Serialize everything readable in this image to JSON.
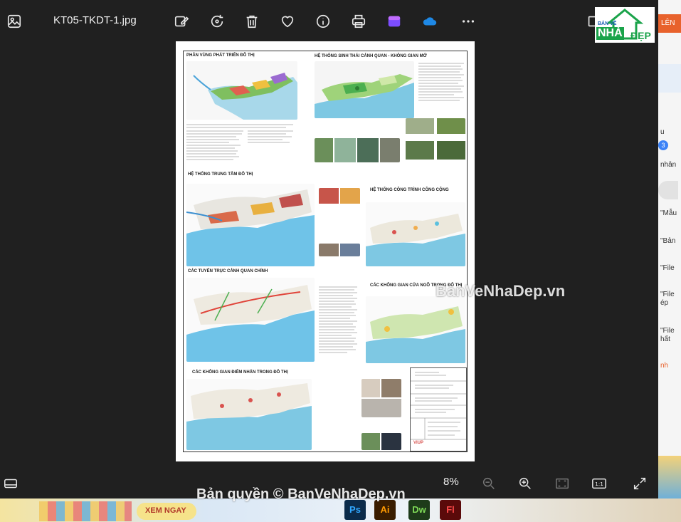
{
  "window": {
    "filename": "KT05-TKDT-1.jpg",
    "zoom": "8%"
  },
  "toolbar": {
    "icons": [
      "gallery-icon",
      "edit-icon",
      "rotate-icon",
      "delete-icon",
      "favorite-icon",
      "info-icon",
      "print-icon",
      "clipchamp-icon",
      "onedrive-icon",
      "more-icon"
    ]
  },
  "logo": {
    "line1": "BẢN VẼ",
    "line2": "NHÀ",
    "line3": "ĐẸP"
  },
  "sheet": {
    "panels": [
      {
        "title": "PHÂN VÙNG PHÁT TRIỂN ĐÔ THỊ"
      },
      {
        "title": "HỆ THỐNG SINH THÁI CẢNH QUAN - KHÔNG GIAN MỞ"
      },
      {
        "title": "HỆ THỐNG TRUNG TÂM ĐÔ THỊ"
      },
      {
        "title": "HỆ THỐNG CÔNG TRÌNH CÔNG CỘNG"
      },
      {
        "title": "CÁC TUYẾN TRỤC CẢNH QUAN CHÍNH"
      },
      {
        "title": "CÁC KHÔNG GIAN CỬA NGÕ TRONG ĐÔ THỊ"
      },
      {
        "title": "CÁC KHÔNG GIAN ĐIỂM NHẤN TRONG ĐÔ THỊ"
      }
    ],
    "viup_label": "VIUP"
  },
  "watermarks": {
    "center": "BanVeNhaDep.vn",
    "bottom": "Bản quyền © BanVeNhaDep.vn"
  },
  "right_panel": {
    "items": [
      "LÊN",
      "u",
      "3",
      "nhân",
      "\"Mẫu",
      "\"Bản",
      "\"File",
      "\"File",
      "ép",
      "\"File",
      "hất",
      "nh"
    ]
  },
  "taskbar": {
    "button": "XEM NGAY",
    "apps": [
      "Ps",
      "Ai",
      "Dw",
      "Fl"
    ]
  },
  "colors": {
    "background": "#202020",
    "accent_orange": "#e8622c",
    "badge_blue": "#3b82f6"
  }
}
